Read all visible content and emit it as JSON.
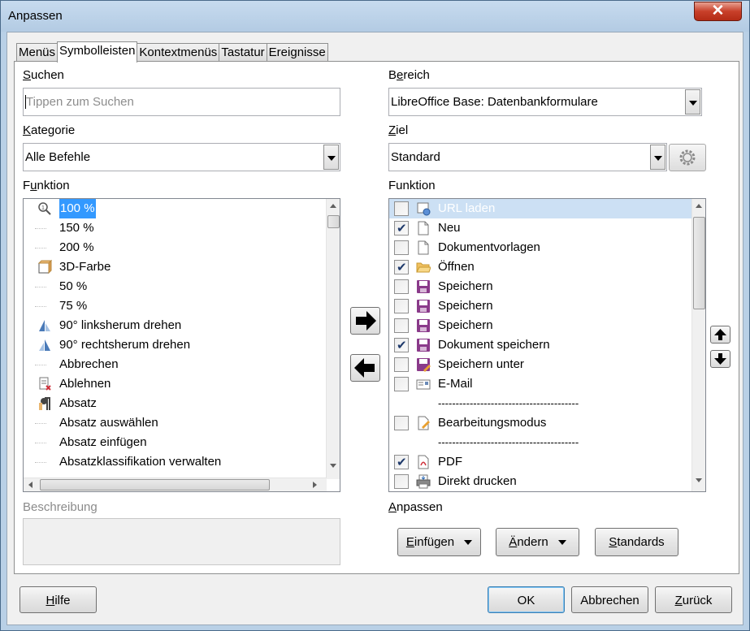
{
  "window": {
    "title": "Anpassen",
    "close_label": "✕"
  },
  "tabs": [
    {
      "label": "Menüs",
      "active": false
    },
    {
      "label": "Symbolleisten",
      "active": true
    },
    {
      "label": "Kontextmenüs",
      "active": false
    },
    {
      "label": "Tastatur",
      "active": false
    },
    {
      "label": "Ereignisse",
      "active": false
    }
  ],
  "left": {
    "search_label": "Suchen",
    "search_placeholder": "Tippen zum Suchen",
    "category_label": "Kategorie",
    "category_value": "Alle Befehle",
    "function_label": "Funktion",
    "functions": [
      {
        "label": "100 %",
        "icon": "zoom-icon",
        "selected": true
      },
      {
        "label": "150 %",
        "icon": ""
      },
      {
        "label": "200 %",
        "icon": ""
      },
      {
        "label": "3D-Farbe",
        "icon": "3d-color-icon"
      },
      {
        "label": "50 %",
        "icon": ""
      },
      {
        "label": "75 %",
        "icon": ""
      },
      {
        "label": "90° linksherum drehen",
        "icon": "rotate-left-icon"
      },
      {
        "label": "90° rechtsherum drehen",
        "icon": "rotate-right-icon"
      },
      {
        "label": "Abbrechen",
        "icon": ""
      },
      {
        "label": "Ablehnen",
        "icon": "reject-icon"
      },
      {
        "label": "Absatz",
        "icon": "paragraph-icon"
      },
      {
        "label": "Absatz auswählen",
        "icon": ""
      },
      {
        "label": "Absatz einfügen",
        "icon": ""
      },
      {
        "label": "Absatzklassifikation verwalten",
        "icon": ""
      }
    ],
    "description_label": "Beschreibung"
  },
  "right": {
    "area_label": "Bereich",
    "area_value": "LibreOffice Base: Datenbankformulare",
    "target_label": "Ziel",
    "target_value": "Standard",
    "function_label": "Funktion",
    "entries": [
      {
        "label": "URL laden",
        "checked": false,
        "icon": "url-load-icon",
        "highlighted": true
      },
      {
        "label": "Neu",
        "checked": true,
        "icon": "new-document-icon"
      },
      {
        "label": "Dokumentvorlagen",
        "checked": false,
        "icon": "template-icon"
      },
      {
        "label": "Öffnen",
        "checked": true,
        "icon": "open-folder-icon"
      },
      {
        "label": "Speichern",
        "checked": false,
        "icon": "save-icon"
      },
      {
        "label": "Speichern",
        "checked": false,
        "icon": "save-icon"
      },
      {
        "label": "Speichern",
        "checked": false,
        "icon": "save-icon"
      },
      {
        "label": "Dokument speichern",
        "checked": true,
        "icon": "save-icon"
      },
      {
        "label": "Speichern unter",
        "checked": false,
        "icon": "save-as-icon"
      },
      {
        "label": "E-Mail",
        "checked": false,
        "icon": "email-icon"
      },
      {
        "separator": true,
        "label": "----------------------------------------"
      },
      {
        "label": "Bearbeitungsmodus",
        "checked": false,
        "icon": "edit-mode-icon"
      },
      {
        "separator": true,
        "label": "----------------------------------------"
      },
      {
        "label": "PDF",
        "checked": true,
        "icon": "pdf-icon"
      },
      {
        "label": "Direkt drucken",
        "checked": false,
        "icon": "print-icon"
      }
    ],
    "customize_label": "Anpassen",
    "insert_button": "Einfügen",
    "modify_button": "Ändern",
    "defaults_button": "Standards"
  },
  "footer": {
    "help": "Hilfe",
    "ok": "OK",
    "cancel": "Abbrechen",
    "reset": "Zurück"
  }
}
